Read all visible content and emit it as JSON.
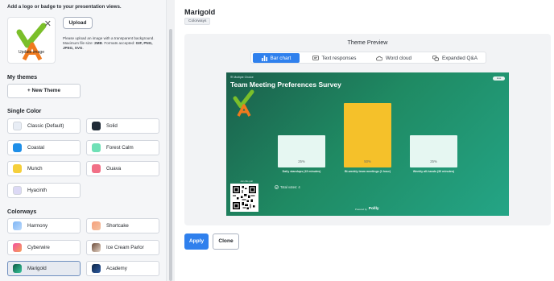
{
  "left": {
    "logo_note": "Add a logo or badge to your presentation views.",
    "logo_caption": "Update image",
    "upload_label": "Upload",
    "upload_help_1": "Please upload an image with a transparent background.",
    "upload_help_2a": "Maximum file size: ",
    "upload_help_size": "2MB",
    "upload_help_2b": ". Formats accepted: ",
    "upload_help_formats": "GIF, PNG, JPEG, SVG",
    "upload_help_end": ".",
    "my_themes_title": "My themes",
    "new_theme_label": "+ New Theme",
    "single_color_title": "Single Color",
    "single_color": [
      {
        "label": "Classic (Default)",
        "color": "#e8edf5"
      },
      {
        "label": "Solid",
        "color": "#1f2a36"
      },
      {
        "label": "Coastal",
        "color": "#1f8fe8"
      },
      {
        "label": "Forest Calm",
        "color": "#6fe0b6"
      },
      {
        "label": "Munch",
        "color": "#f5cf3b"
      },
      {
        "label": "Guava",
        "color": "#f16f86"
      },
      {
        "label": "Hyacinth",
        "color": "#dcd9f5"
      }
    ],
    "colorways_title": "Colorways",
    "colorways": [
      {
        "label": "Harmony",
        "colors": [
          "#7fb6f5",
          "#b9d8fb"
        ]
      },
      {
        "label": "Shortcake",
        "colors": [
          "#f6a07c",
          "#f3c1a1"
        ]
      },
      {
        "label": "Cyberwire",
        "colors": [
          "#f24fa0",
          "#f6a25a"
        ]
      },
      {
        "label": "Ice Cream Parlor",
        "colors": [
          "#6b4b3a",
          "#e7d6c8"
        ]
      },
      {
        "label": "Marigold",
        "colors": [
          "#0f5a44",
          "#38c79c"
        ]
      },
      {
        "label": "Academy",
        "colors": [
          "#0f2748",
          "#2d5aa0"
        ]
      }
    ]
  },
  "right": {
    "title": "Marigold",
    "tag": "Colorways",
    "preview_title": "Theme Preview",
    "tabs": [
      "Bar chart",
      "Text responses",
      "Word cloud",
      "Expanded Q&A"
    ],
    "apply_label": "Apply",
    "clone_label": "Clone"
  },
  "slide": {
    "question_type": "Multiple Choice",
    "title": "Team Meeting Preferences Survey",
    "toggle": "Live",
    "join_label": "Join this poll",
    "total_votes": "Total votes: 4",
    "powered_by": "Powered by",
    "brand": "Pollly"
  },
  "chart_data": {
    "type": "bar",
    "categories": [
      "Daily standups (15 minutes)",
      "Bi-weekly team meetings (1 hour)",
      "Weekly all-hands (30 minutes)"
    ],
    "values": [
      25,
      50,
      25
    ],
    "value_labels": [
      "25%",
      "50%",
      "25%"
    ],
    "colors": [
      "#e6f7f2",
      "#f5c12a",
      "#e6f7f2"
    ],
    "ylim": [
      0,
      50
    ]
  }
}
